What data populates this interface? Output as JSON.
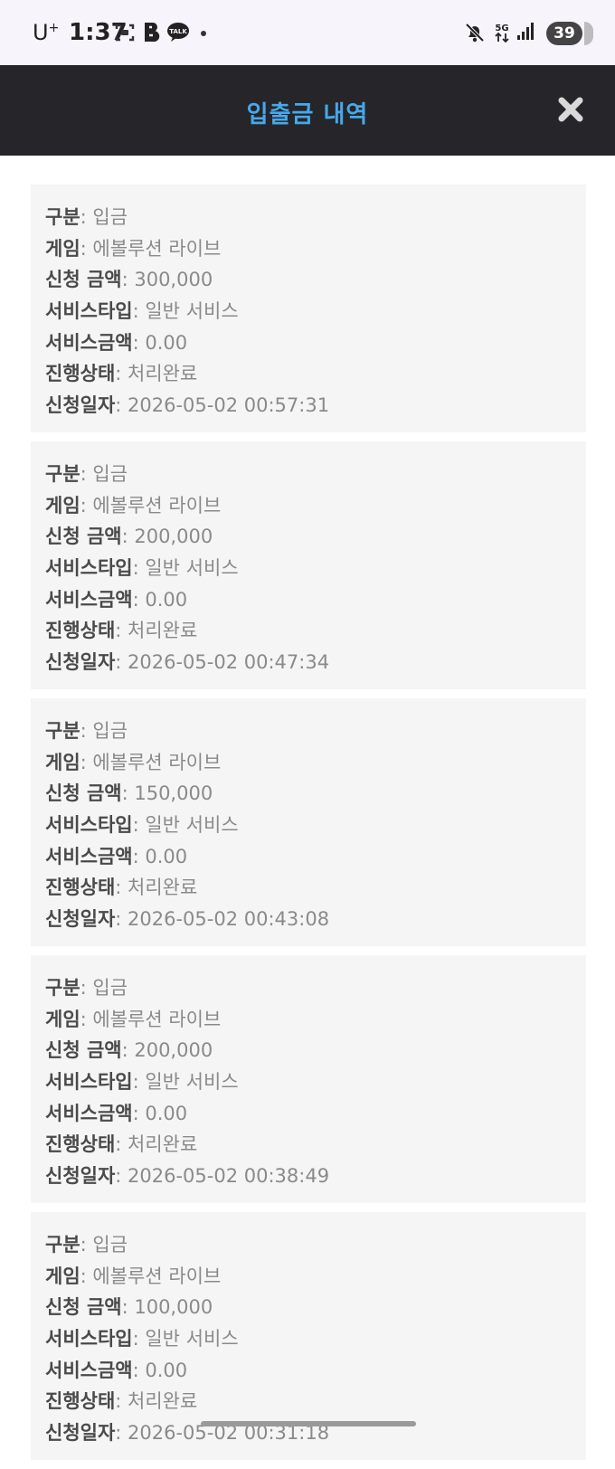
{
  "status_bar": {
    "carrier": "U",
    "carrier_sup": "+",
    "time": "1:37",
    "battery": "39",
    "network": "5G",
    "icons": [
      "screenshot-icon",
      "b-app-icon",
      "kakaotalk-icon",
      "mute-icon",
      "network-5g-icon",
      "signal-icon"
    ]
  },
  "header": {
    "title": "입출금 내역",
    "close_icon": "close-icon",
    "title_color": "#47a8ea",
    "background": "#25252a"
  },
  "labels": {
    "type": "구분",
    "game": "게임",
    "amount": "신청 금액",
    "service_type": "서비스타입",
    "service_amount": "서비스금액",
    "status": "진행상태",
    "date": "신청일자"
  },
  "records": [
    {
      "type": ": 입금",
      "game": ": 에볼루션 라이브",
      "amount": ": 300,000",
      "service_type": ": 일반 서비스",
      "service_amount": ": 0.00",
      "status": ": 처리완료",
      "date": ": 2026-05-02 00:57:31"
    },
    {
      "type": ": 입금",
      "game": ": 에볼루션 라이브",
      "amount": ": 200,000",
      "service_type": ": 일반 서비스",
      "service_amount": ": 0.00",
      "status": ": 처리완료",
      "date": ": 2026-05-02 00:47:34"
    },
    {
      "type": ": 입금",
      "game": ": 에볼루션 라이브",
      "amount": ": 150,000",
      "service_type": ": 일반 서비스",
      "service_amount": ": 0.00",
      "status": ": 처리완료",
      "date": ": 2026-05-02 00:43:08"
    },
    {
      "type": ": 입금",
      "game": ": 에볼루션 라이브",
      "amount": ": 200,000",
      "service_type": ": 일반 서비스",
      "service_amount": ": 0.00",
      "status": ": 처리완료",
      "date": ": 2026-05-02 00:38:49"
    },
    {
      "type": ": 입금",
      "game": ": 에볼루션 라이브",
      "amount": ": 100,000",
      "service_type": ": 일반 서비스",
      "service_amount": ": 0.00",
      "status": ": 처리완료",
      "date": ": 2026-05-02 00:31:18"
    }
  ]
}
